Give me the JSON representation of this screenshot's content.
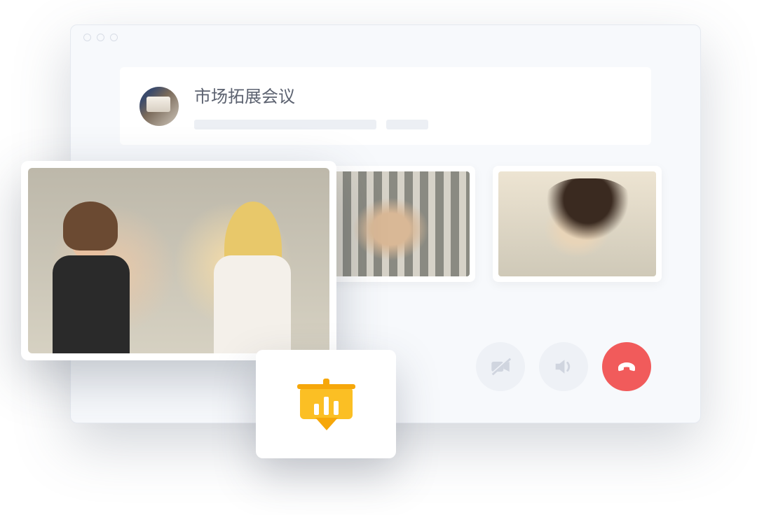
{
  "header": {
    "meeting_title": "市场拓展会议"
  },
  "icons": {
    "camera_off": "camera-off-icon",
    "speaker": "speaker-icon",
    "hangup": "phone-hangup-icon",
    "presentation": "presentation-board-icon"
  },
  "colors": {
    "hangup_bg": "#f15b5b",
    "control_muted_bg": "#eef1f6",
    "control_muted_fg": "#d0d5df",
    "accent_yellow": "#fbbf24"
  }
}
